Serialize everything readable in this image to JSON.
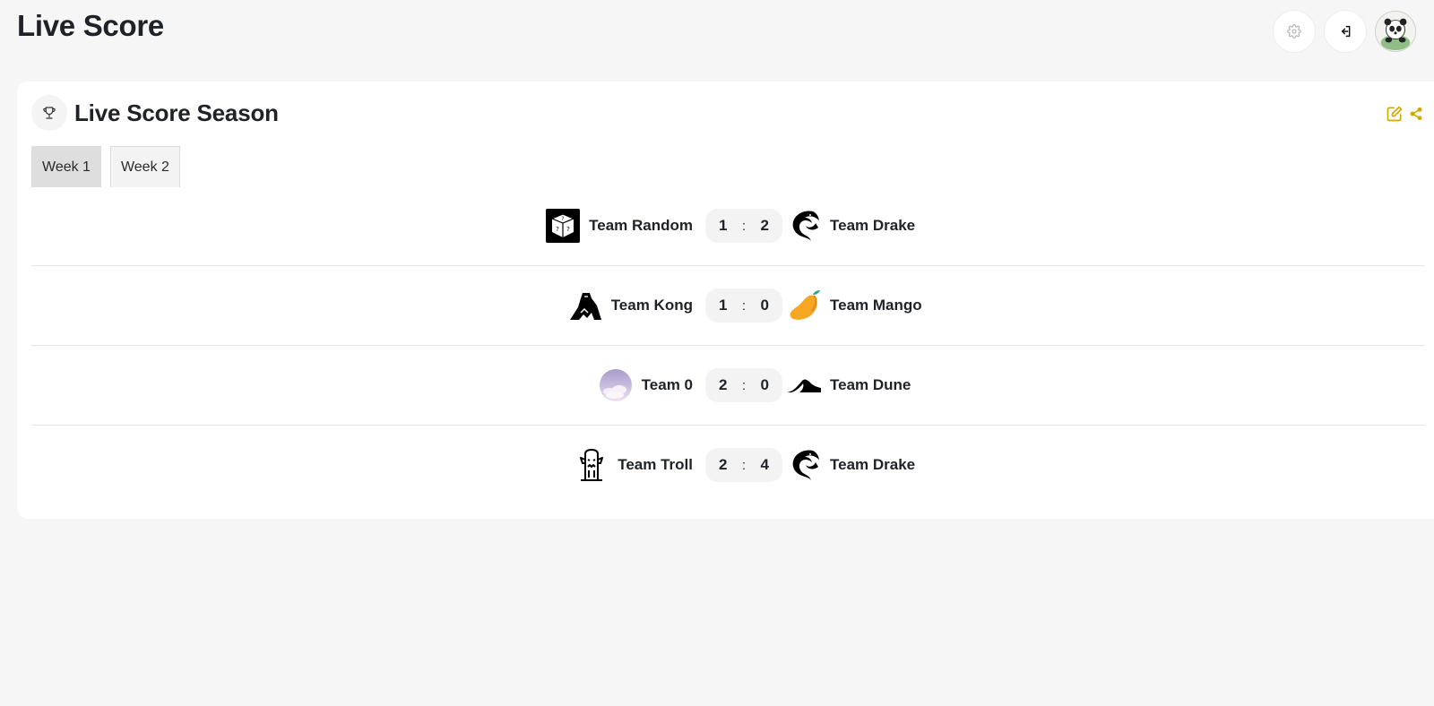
{
  "header": {
    "title": "Live Score"
  },
  "top_actions": {
    "settings_icon": "gear-icon",
    "logout_icon": "logout-icon",
    "avatar_icon": "panda-avatar"
  },
  "season": {
    "title": "Live Score Season",
    "icon": "trophy-icon",
    "accent_color": "#d4a800",
    "tools": [
      "edit-icon",
      "share-icon"
    ]
  },
  "tabs": [
    {
      "label": "Week 1",
      "active": true
    },
    {
      "label": "Week 2",
      "active": false
    }
  ],
  "matches": [
    {
      "home": {
        "name": "Team Random",
        "logo": "dice-icon"
      },
      "home_score": "1",
      "away_score": "2",
      "away": {
        "name": "Team Drake",
        "logo": "dragon-icon"
      }
    },
    {
      "home": {
        "name": "Team Kong",
        "logo": "gorilla-icon"
      },
      "home_score": "1",
      "away_score": "0",
      "away": {
        "name": "Team Mango",
        "logo": "mango-icon"
      }
    },
    {
      "home": {
        "name": "Team 0",
        "logo": "cloud-icon"
      },
      "home_score": "2",
      "away_score": "0",
      "away": {
        "name": "Team Dune",
        "logo": "dune-icon"
      }
    },
    {
      "home": {
        "name": "Team Troll",
        "logo": "troll-icon"
      },
      "home_score": "2",
      "away_score": "4",
      "away": {
        "name": "Team Drake",
        "logo": "dragon-icon"
      }
    }
  ],
  "score_separator": ":"
}
